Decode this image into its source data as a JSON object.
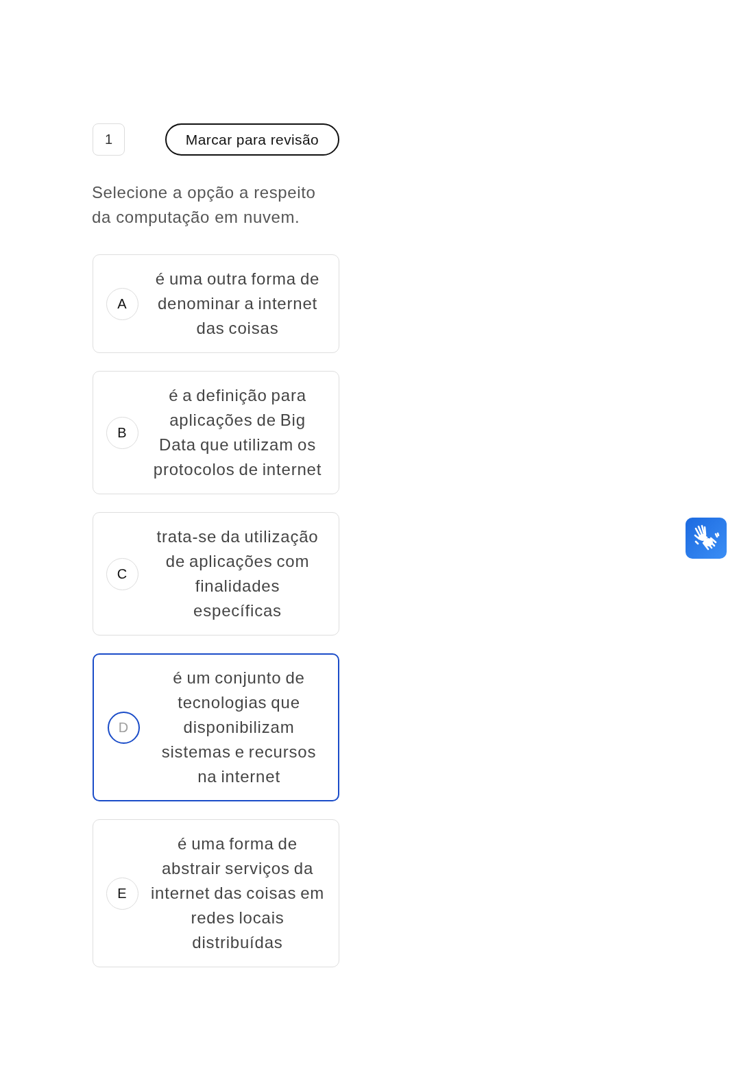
{
  "question_number": "1",
  "review_button": {
    "label": "Marcar para revisão"
  },
  "question": "Selecione a opção a respeito da computação em nuvem.",
  "options": [
    {
      "letter": "A",
      "text": "é uma outra forma de denominar a internet das coisas",
      "selected": false
    },
    {
      "letter": "B",
      "text": "é a definição para aplicações de Big Data que utilizam os protocolos de internet",
      "selected": false
    },
    {
      "letter": "C",
      "text": "trata-se da utilização de aplicações com finalidades específicas",
      "selected": false
    },
    {
      "letter": "D",
      "text": "é um conjunto de tecnologias que disponibilizam sistemas e recursos na internet",
      "selected": true
    },
    {
      "letter": "E",
      "text": "é uma forma de abstrair serviços da internet das coisas em redes locais distribuídas",
      "selected": false
    }
  ]
}
